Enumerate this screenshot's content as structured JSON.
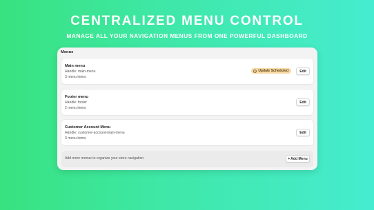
{
  "hero": {
    "title": "CENTRALIZED MENU CONTROL",
    "subtitle": "MANAGE ALL YOUR NAVIGATION MENUS FROM ONE POWERFUL DASHBOARD"
  },
  "panel": {
    "title": "Menus",
    "menus": [
      {
        "name": "Main menu",
        "handle": "Handle: main-menu",
        "items": "3 menu items",
        "badge": "Update Scheduled",
        "edit_label": "Edit"
      },
      {
        "name": "Footer menu",
        "handle": "Handle: footer",
        "items": "2 menu items",
        "edit_label": "Edit"
      },
      {
        "name": "Customer Account Menu",
        "handle": "Handle: customer-account-main-menu",
        "items": "3 menu items",
        "edit_label": "Edit"
      }
    ],
    "footer": {
      "text": "Add more menus to organize your store navigation",
      "add_plus": "+",
      "add_label": "Add Menu"
    }
  },
  "icons": {
    "badge_icon": "clock-icon"
  },
  "colors": {
    "background_start": "#38e27f",
    "background_end": "#46ecd0",
    "badge_bg": "#f8d9a8",
    "badge_text": "#5e4513"
  }
}
